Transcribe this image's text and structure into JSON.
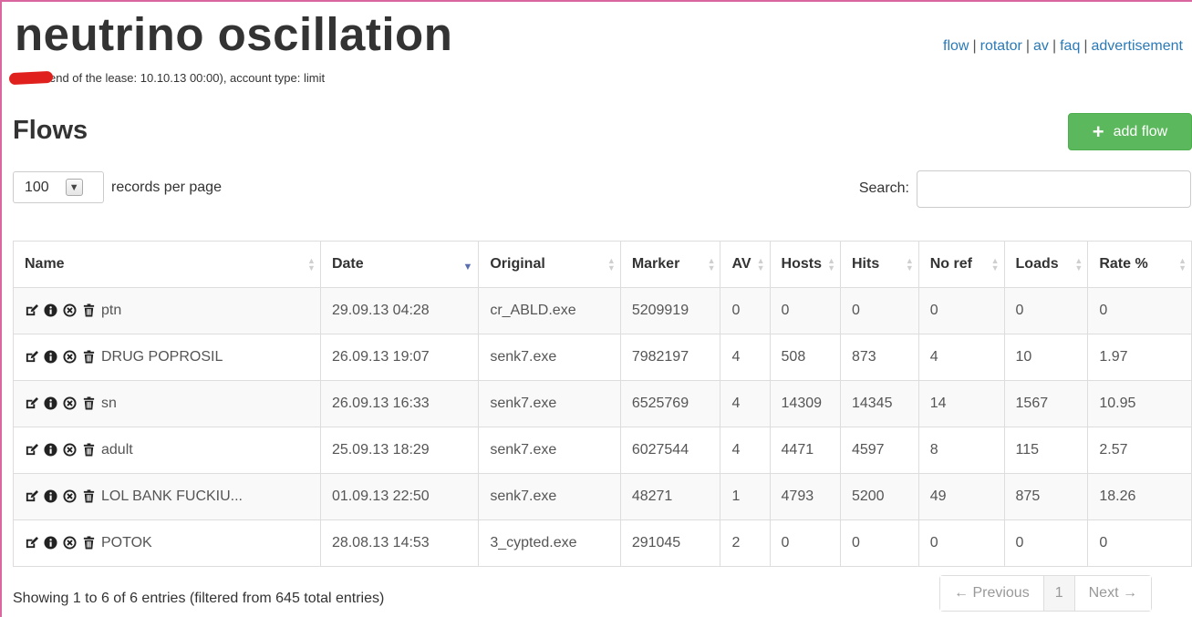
{
  "header": {
    "brand": "neutrino oscillation",
    "lease_text": "end of the lease: 10.10.13 00:00), account type: limit"
  },
  "nav": {
    "flow": "flow",
    "rotator": "rotator",
    "av": "av",
    "faq": "faq",
    "advertisement": "advertisement",
    "separator": "|"
  },
  "page": {
    "title": "Flows",
    "add_button": "add flow"
  },
  "controls": {
    "per_page_value": "100",
    "per_page_label": "records per page",
    "search_label": "Search:",
    "search_value": ""
  },
  "table": {
    "columns": [
      "Name",
      "Date",
      "Original",
      "Marker",
      "AV",
      "Hosts",
      "Hits",
      "No ref",
      "Loads",
      "Rate %"
    ],
    "sorted_column": "Date",
    "sort_direction": "descending",
    "rows": [
      [
        "ptn",
        "29.09.13 04:28",
        "cr_ABLD.exe",
        "5209919",
        "0",
        "0",
        "0",
        "0",
        "0",
        "0"
      ],
      [
        "DRUG POPROSIL",
        "26.09.13 19:07",
        "senk7.exe",
        "7982197",
        "4",
        "508",
        "873",
        "4",
        "10",
        "1.97"
      ],
      [
        "sn",
        "26.09.13 16:33",
        "senk7.exe",
        "6525769",
        "4",
        "14309",
        "14345",
        "14",
        "1567",
        "10.95"
      ],
      [
        "adult",
        "25.09.13 18:29",
        "senk7.exe",
        "6027544",
        "4",
        "4471",
        "4597",
        "8",
        "115",
        "2.57"
      ],
      [
        "LOL BANK FUCKIU...",
        "01.09.13 22:50",
        "senk7.exe",
        "48271",
        "1",
        "4793",
        "5200",
        "49",
        "875",
        "18.26"
      ],
      [
        "POTOK",
        "28.08.13 14:53",
        "3_cypted.exe",
        "291045",
        "2",
        "0",
        "0",
        "0",
        "0",
        "0"
      ]
    ],
    "row_actions": [
      "edit-icon",
      "info-icon",
      "disable-icon",
      "trash-icon"
    ]
  },
  "footer": {
    "info": "Showing 1 to 6 of 6 entries (filtered from 645 total entries)",
    "prev": "← Previous",
    "page": "1",
    "next": "Next →"
  },
  "colors": {
    "accent_link": "#2a7ab8",
    "add_button": "#5cb85c",
    "frame": "#d9669e",
    "redaction": "#e0201c"
  }
}
